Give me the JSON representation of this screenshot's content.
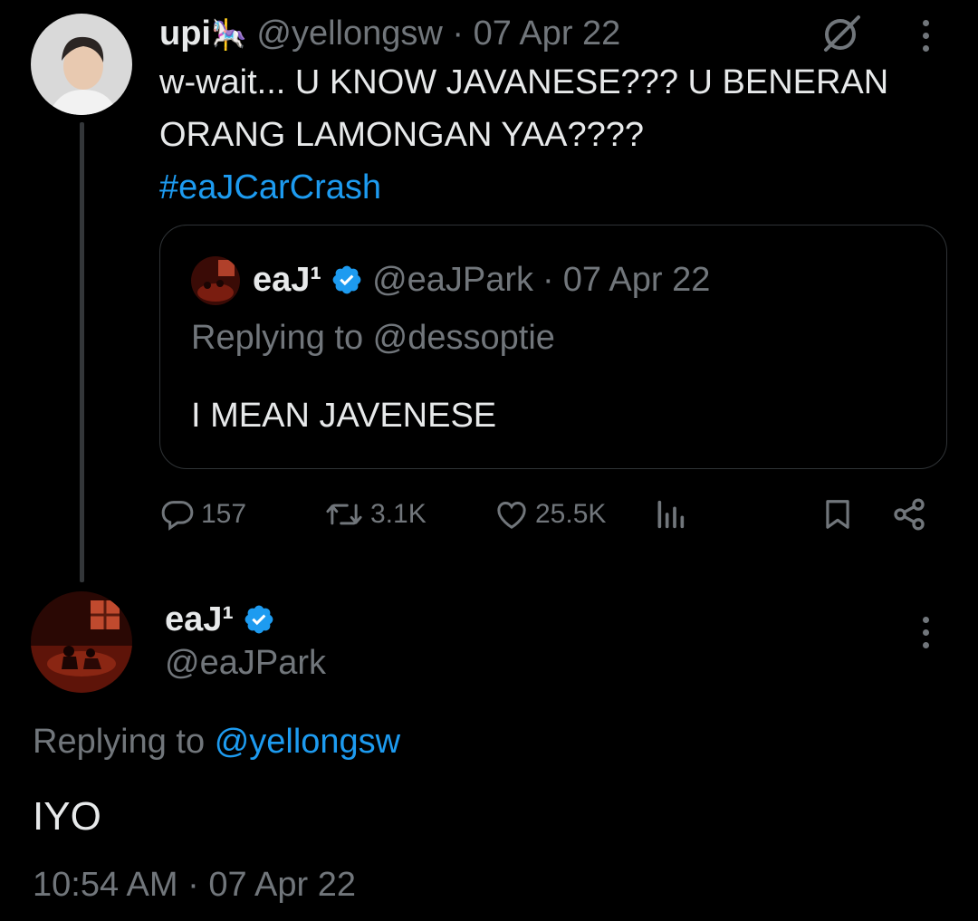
{
  "tweet1": {
    "display_name": "upi",
    "name_emoji": "🎠",
    "handle": "@yellongsw",
    "separator": "·",
    "date": "07 Apr 22",
    "text_line1": "w-wait... U KNOW JAVANESE??? U BENERAN",
    "text_line2": "ORANG LAMONGAN YAA????",
    "hashtag": "#eaJCarCrash",
    "quote": {
      "display_name": "eaJ¹",
      "handle": "@eaJPark",
      "separator": "·",
      "date": "07 Apr 22",
      "replying_to": "Replying to @dessoptie",
      "text": "I MEAN JAVENESE"
    },
    "actions": {
      "replies": "157",
      "retweets": "3.1K",
      "likes": "25.5K"
    }
  },
  "tweet2": {
    "display_name": "eaJ¹",
    "handle": "@eaJPark",
    "replying_label": "Replying to",
    "replying_handle": "@yellongsw",
    "text": "IYO",
    "timestamp": "10:54 AM · 07 Apr 22"
  },
  "colors": {
    "background": "#000000",
    "text": "#e7e9ea",
    "muted": "#71767b",
    "link": "#1d9bf0",
    "verified": "#1d9bf0",
    "border": "#2f3336"
  },
  "icons": [
    "grok-icon",
    "more-icon",
    "verified-badge-icon",
    "reply-icon",
    "retweet-icon",
    "like-icon",
    "views-icon",
    "bookmark-icon",
    "share-icon"
  ]
}
